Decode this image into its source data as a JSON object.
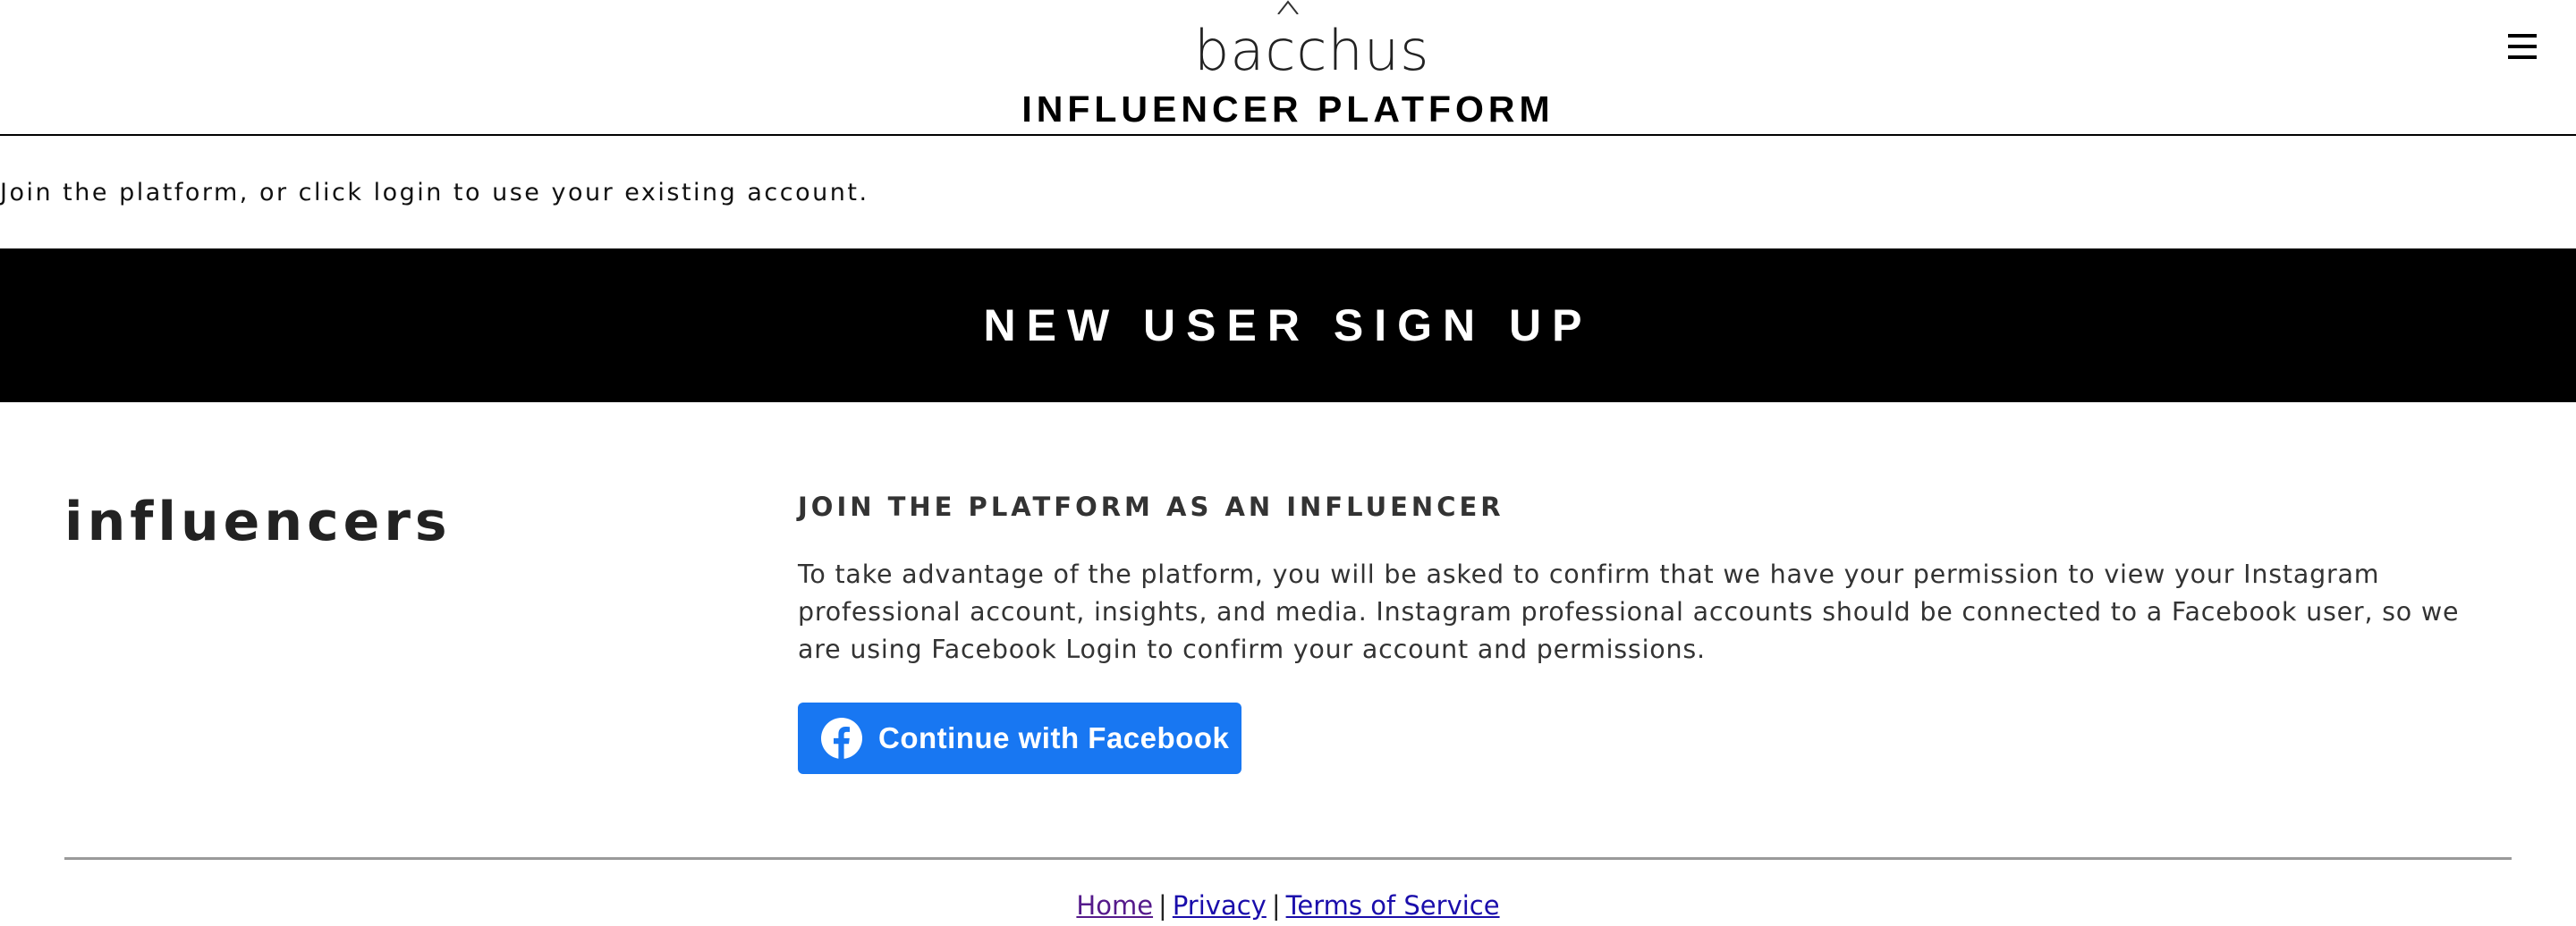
{
  "header": {
    "logo_text": "bacchus",
    "platform_title": "INFLUENCER PLATFORM",
    "menu_icon": "hamburger-menu-icon"
  },
  "intro": {
    "text": "Join the platform, or click login to use your existing account."
  },
  "banner": {
    "text": "NEW USER SIGN UP"
  },
  "section": {
    "title": "influencers",
    "heading": "JOIN THE PLATFORM AS AN INFLUENCER",
    "body": "To take advantage of the platform, you will be asked to confirm that we have your permission to view your Instagram professional account, insights, and media. Instagram professional accounts should be connected to a Facebook user, so we are using Facebook Login to confirm your account and permissions.",
    "facebook_button": {
      "label": "Continue with Facebook",
      "icon": "facebook-logo-icon",
      "color": "#1877f2"
    }
  },
  "footer": {
    "links": [
      {
        "label": "Home"
      },
      {
        "label": "Privacy"
      },
      {
        "label": "Terms of Service"
      }
    ],
    "separator": "|"
  }
}
